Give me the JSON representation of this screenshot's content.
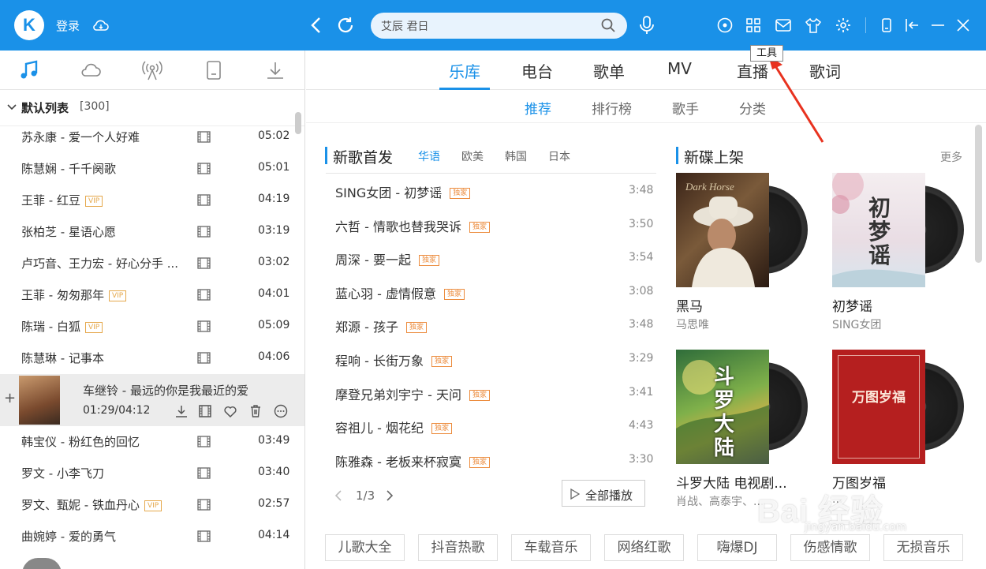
{
  "app": {
    "logo_letter": "K",
    "login_label": "登录",
    "search_value": "艾辰 君日",
    "tooltip": "工具",
    "accent_color": "#1a91e8"
  },
  "toolbar_icons": [
    "cloud-icon",
    "back-icon",
    "refresh-icon",
    "search-icon",
    "mic-icon",
    "disc-icon",
    "apps-icon",
    "mail-icon",
    "skin-icon",
    "settings-icon",
    "phone-icon",
    "sidebar-toggle-icon",
    "minimize-icon",
    "close-icon"
  ],
  "left_tabs": [
    "music-note-icon",
    "cloud-icon",
    "radio-icon",
    "device-icon",
    "download-icon"
  ],
  "playlist": {
    "title": "默认列表",
    "count": "[300]",
    "songs_top": [
      {
        "name": "苏永康 - 爱一个人好难",
        "vip": "",
        "duration": "05:02"
      },
      {
        "name": "陈慧娴 - 千千阕歌",
        "vip": "",
        "duration": "05:01"
      },
      {
        "name": "王菲 - 红豆",
        "vip": "VIP",
        "duration": "04:19"
      },
      {
        "name": "张柏芝 - 星语心愿",
        "vip": "",
        "duration": "03:19"
      },
      {
        "name": "卢巧音、王力宏 - 好心分手 ...",
        "vip": "",
        "duration": "03:02"
      },
      {
        "name": "王菲 - 匆匆那年",
        "vip": "VIP",
        "duration": "04:01"
      },
      {
        "name": "陈瑞 - 白狐",
        "vip": "VIP",
        "duration": "05:09"
      },
      {
        "name": "陈慧琳 - 记事本",
        "vip": "",
        "duration": "04:06"
      }
    ],
    "now_playing": {
      "name": "车继铃 - 最远的你是我最近的爱",
      "time": "01:29/04:12"
    },
    "songs_bottom": [
      {
        "name": "韩宝仪 - 粉红色的回忆",
        "vip": "",
        "duration": "03:49"
      },
      {
        "name": "罗文 - 小李飞刀",
        "vip": "",
        "duration": "03:40"
      },
      {
        "name": "罗文、甄妮 - 铁血丹心",
        "vip": "VIP",
        "duration": "02:57"
      },
      {
        "name": "曲婉婷 - 爱的勇气",
        "vip": "",
        "duration": "04:14"
      }
    ]
  },
  "main_tabs": [
    "乐库",
    "电台",
    "歌单",
    "MV",
    "直播",
    "歌词"
  ],
  "sub_tabs": [
    "推荐",
    "排行榜",
    "歌手",
    "分类"
  ],
  "new_songs": {
    "title": "新歌首发",
    "filters": [
      "华语",
      "欧美",
      "韩国",
      "日本"
    ],
    "tag": "独家",
    "items": [
      {
        "name": "SING女团 - 初梦谣",
        "duration": "3:48"
      },
      {
        "name": "六哲 - 情歌也替我哭诉",
        "duration": "3:50"
      },
      {
        "name": "周深 - 要一起",
        "duration": "3:54"
      },
      {
        "name": "蓝心羽 - 虚情假意",
        "duration": "3:08"
      },
      {
        "name": "郑源 - 孩子",
        "duration": "3:48"
      },
      {
        "name": "程响 - 长街万象",
        "duration": "3:29"
      },
      {
        "name": "摩登兄弟刘宇宁 - 天问",
        "duration": "3:41"
      },
      {
        "name": "容祖儿 - 烟花纪",
        "duration": "4:43"
      },
      {
        "name": "陈雅森 - 老板来杯寂寞",
        "duration": "3:30"
      }
    ],
    "page": "1/3",
    "play_all": "全部播放"
  },
  "new_albums": {
    "title": "新碟上架",
    "more": "更多",
    "items": [
      {
        "title": "黑马",
        "artist": "马思唯"
      },
      {
        "title": "初梦谣",
        "artist": "SING女团"
      },
      {
        "title": "斗罗大陆 电视剧...",
        "artist": "肖战、高泰宇、..."
      },
      {
        "title": "万图岁福",
        "artist": "..."
      }
    ],
    "cover_texts": {
      "album1": "Dark Horse",
      "album2": "初梦谣",
      "album3": "斗罗大陆",
      "album4": "万图岁福"
    }
  },
  "chips": [
    "儿歌大全",
    "抖音热歌",
    "车载音乐",
    "网络红歌",
    "嗨爆DJ",
    "伤感情歌",
    "无损音乐"
  ],
  "watermark": {
    "main": "Bai 经验",
    "sub": "jingyan.baidu.com"
  }
}
